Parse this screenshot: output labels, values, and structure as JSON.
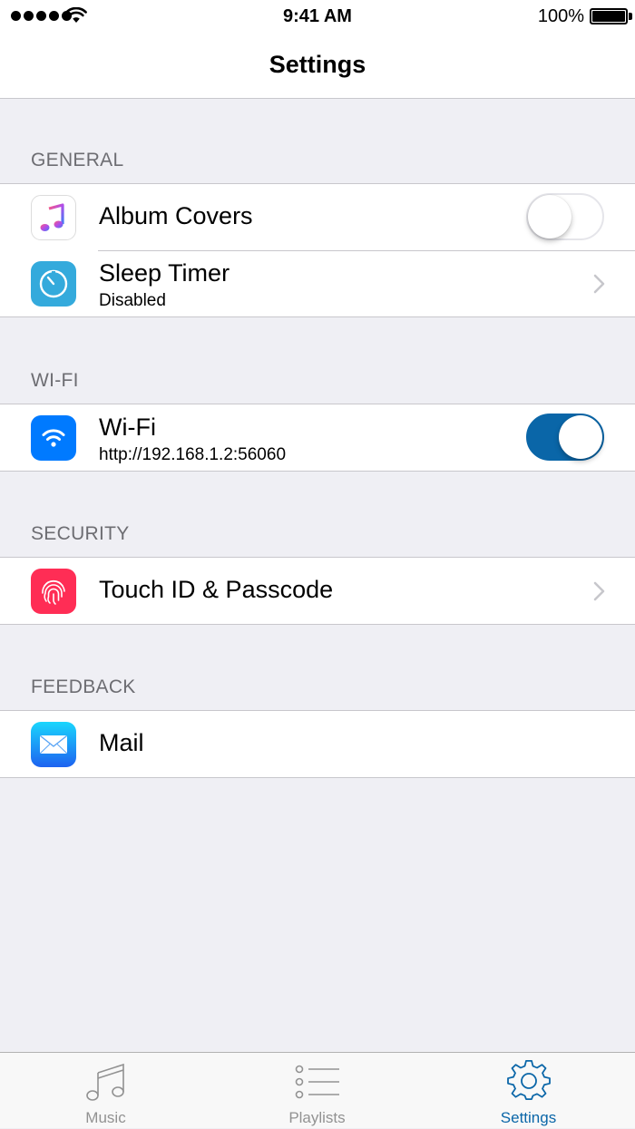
{
  "status_bar": {
    "time": "9:41 AM",
    "battery_percent": "100%",
    "icons": [
      "signal-dots-icon",
      "wifi-icon",
      "battery-icon"
    ]
  },
  "nav": {
    "title": "Settings"
  },
  "sections": {
    "general": {
      "header": "GENERAL",
      "album_covers": {
        "label": "Album Covers",
        "icon": "music-note-icon",
        "toggle_on": false
      },
      "sleep_timer": {
        "label": "Sleep Timer",
        "subtitle": "Disabled",
        "icon": "timer-icon"
      }
    },
    "wifi": {
      "header": "WI-FI",
      "wifi_row": {
        "label": "Wi-Fi",
        "subtitle": "http://192.168.1.2:56060",
        "icon": "wifi-icon",
        "toggle_on": true
      }
    },
    "security": {
      "header": "SECURITY",
      "touch_id": {
        "label": "Touch ID & Passcode",
        "icon": "fingerprint-icon"
      }
    },
    "feedback": {
      "header": "FEEDBACK",
      "mail": {
        "label": "Mail",
        "icon": "mail-icon"
      }
    }
  },
  "tab_bar": {
    "tabs": [
      {
        "label": "Music",
        "icon": "music-note-icon",
        "active": false
      },
      {
        "label": "Playlists",
        "icon": "list-icon",
        "active": false
      },
      {
        "label": "Settings",
        "icon": "gear-icon",
        "active": true
      }
    ]
  },
  "colors": {
    "accent": "#0a66a8",
    "background": "#efeff4",
    "inactive_tab": "#929292",
    "touch_id_icon": "#ff2d55",
    "sleep_timer_icon": "#34aadc",
    "wifi_icon": "#007aff"
  }
}
